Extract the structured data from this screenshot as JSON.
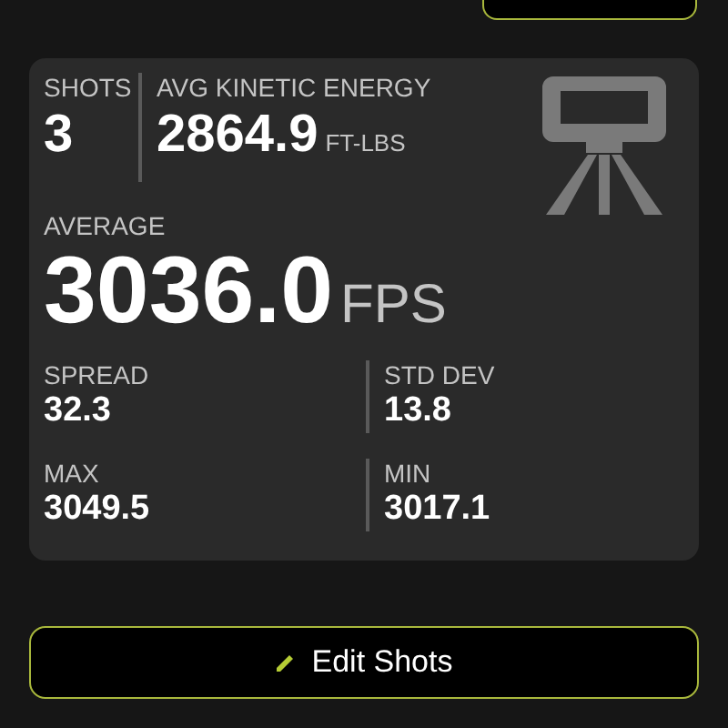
{
  "summary": {
    "shots": {
      "label": "SHOTS",
      "value": "3"
    },
    "kinetic_energy": {
      "label": "AVG KINETIC ENERGY",
      "value": "2864.9",
      "unit": "FT-LBS"
    },
    "average": {
      "label": "AVERAGE",
      "value": "3036.0",
      "unit": "FPS"
    },
    "stats": [
      {
        "label": "SPREAD",
        "value": "32.3"
      },
      {
        "label": "STD DEV",
        "value": "13.8"
      },
      {
        "label": "MAX",
        "value": "3049.5"
      },
      {
        "label": "MIN",
        "value": "3017.1"
      }
    ]
  },
  "edit_button": {
    "label": "Edit Shots"
  }
}
